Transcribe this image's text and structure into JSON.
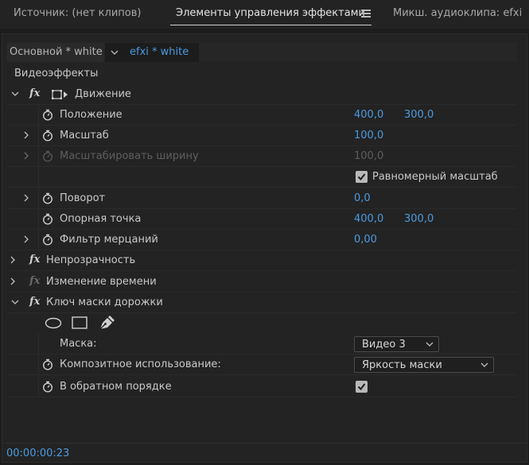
{
  "tabs": {
    "source": "Источник: (нет клипов)",
    "effect_controls": "Элементы управления эффектами",
    "audio_mixer": "Микш. аудиоклипа: efxi"
  },
  "clip_header": {
    "master": "Основной * white",
    "sequence": "efxi * white"
  },
  "section": "Видеоэффекты",
  "motion": {
    "title": "Движение",
    "position": {
      "label": "Положение",
      "x": "400,0",
      "y": "300,0"
    },
    "scale": {
      "label": "Масштаб",
      "value": "100,0"
    },
    "scale_width": {
      "label": "Масштабировать ширину",
      "value": "100,0"
    },
    "uniform_scale": {
      "label": "Равномерный масштаб",
      "checked": true
    },
    "rotation": {
      "label": "Поворот",
      "value": "0,0"
    },
    "anchor": {
      "label": "Опорная точка",
      "x": "400,0",
      "y": "300,0"
    },
    "flicker": {
      "label": "Фильтр мерцаний",
      "value": "0,00"
    }
  },
  "opacity": {
    "title": "Непрозрачность"
  },
  "time_remap": {
    "title": "Изменение времени"
  },
  "track_matte": {
    "title": "Ключ маски дорожки",
    "matte": {
      "label": "Маска:",
      "value": "Видео 3"
    },
    "composite": {
      "label": "Композитное использование:",
      "value": "Яркость маски"
    },
    "reverse": {
      "label": "В обратном порядке",
      "checked": true
    }
  },
  "icons": {
    "fx": "fx",
    "stopwatch": "stopwatch-icon",
    "twisty": "chevron-icon",
    "ellipse": "ellipse-mask-icon",
    "rect": "rectangle-mask-icon",
    "pen": "pen-mask-icon"
  },
  "colors": {
    "accent_blue": "#4a9bdf",
    "panel_bg": "#232323"
  },
  "timecode": "00:00:00:23"
}
